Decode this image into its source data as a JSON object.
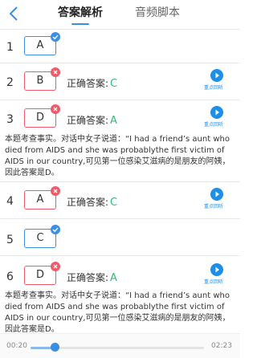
{
  "tabs": [
    "答案解析",
    "音频脚本"
  ],
  "correct_label": "正确答案:",
  "play_caption": "重点回听",
  "questions": [
    {
      "num": "1",
      "choice": "A"
    },
    {
      "num": "2",
      "choice": "B",
      "correct": "C"
    },
    {
      "num": "3",
      "choice": "D",
      "correct": "A"
    },
    {
      "num": "4",
      "choice": "A",
      "correct": "C"
    },
    {
      "num": "5",
      "choice": "C"
    },
    {
      "num": "6",
      "choice": "D",
      "correct": "A"
    }
  ],
  "explanations": [
    "本题考查事实。对话中女子说道：“I had a friend’s aunt who died from AIDS and she was probablythe first victim of AIDS in our country,可见第一位感染艾滋病的是朋友的阿姨，因此答案是D。",
    "本题考查事实。对话中女子说道：“I had a friend’s aunt who died from AIDS and she was probablythe first victim of AIDS in our country,可见第一位感染艾滋病的是朋友的阿姨，因此答案是D。"
  ],
  "player": {
    "current": "00:20",
    "total": "02:23",
    "progress": 0.14
  },
  "colors": {
    "accent": "#3a8ee6",
    "wrong": "#f05a6a",
    "correct": "#3ab87a",
    "play": "#1e8fe8"
  }
}
